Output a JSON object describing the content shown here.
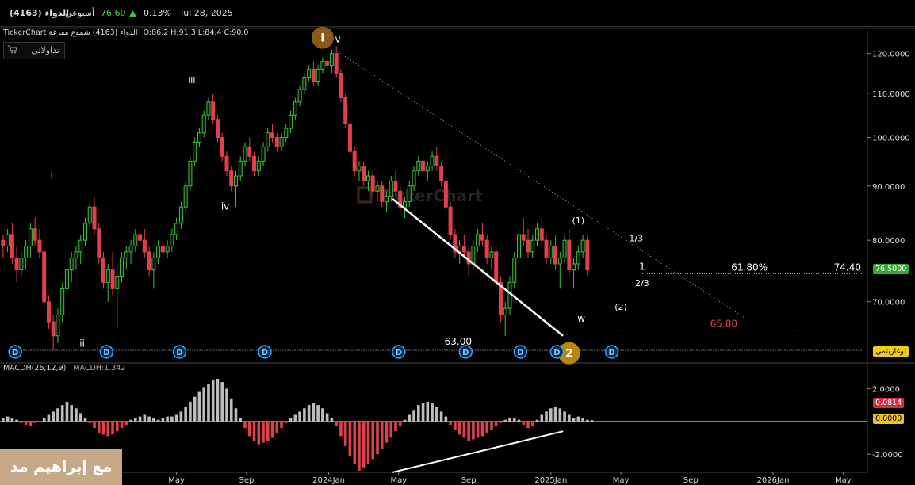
{
  "header": {
    "symbol": "الدواء (4163)",
    "period": "أسبوعي",
    "price": "76.60",
    "change_pct": "0.13%",
    "date": "Jul 28, 2025"
  },
  "info_line": {
    "brand": "TickerChart",
    "symbol": "الدواء (4163)",
    "chart_style": "شموع مفرغة",
    "ohlc": "O:86.2  H:91.3  L:84.4  C:90.0"
  },
  "toolbar": {
    "platform_label": "تداولاتي"
  },
  "watermark_text": "TickerChart",
  "footer_watermark": "مع إبراهيم مد",
  "colors": {
    "up": "#3fbf3f",
    "down": "#e0404a",
    "macd_up": "#bdbdbd",
    "macd_down": "#e0404a",
    "zero_line": "#e8a317",
    "price_tag": "#33aa33"
  },
  "chart_data": [
    {
      "type": "candlestick",
      "y_axis_labels": [
        "120.0000",
        "110.0000",
        "100.0000",
        "90.0000",
        "80.0000",
        "70.0000"
      ],
      "y_ticks": [
        120,
        110,
        100,
        90,
        80,
        70
      ],
      "ylim": [
        61.6,
        126.5
      ],
      "x_tick_labels": [
        "2023Jan",
        "May",
        "Sep",
        "2024Jan",
        "May",
        "Sep",
        "2025Jan",
        "May",
        "Sep",
        "2026Jan",
        "May"
      ],
      "x_tick_positions": [
        0.1,
        0.33,
        0.56,
        0.83,
        1.06,
        1.29,
        1.56,
        1.79,
        2.02,
        2.29,
        2.52
      ],
      "x_range": [
        -0.25,
        2.6
      ],
      "current_price": "76.5000",
      "scale_button": "لوغاريتمي",
      "levels": [
        {
          "value": 74.4,
          "label": "74.40",
          "pct_label": "61.80%"
        },
        {
          "value": 65.8,
          "label": "65.80"
        },
        {
          "value": 63.0,
          "label": "63.00"
        }
      ],
      "wave_labels": [
        {
          "text": "i",
          "t": -0.08,
          "y": 91.5
        },
        {
          "text": "ii",
          "t": 0.02,
          "y": 63.5
        },
        {
          "text": "iii",
          "t": 0.38,
          "y": 112.5
        },
        {
          "text": "iv",
          "t": 0.49,
          "y": 85.5
        },
        {
          "text": "v",
          "t": 0.86,
          "y": 123.0
        },
        {
          "text": "(1)",
          "t": 1.65,
          "y": 83.0
        },
        {
          "text": "(2)",
          "t": 1.79,
          "y": 68.8
        },
        {
          "text": "w",
          "t": 1.66,
          "y": 67.0
        },
        {
          "text": "1/3",
          "t": 1.84,
          "y": 79.8
        },
        {
          "text": "1",
          "t": 1.86,
          "y": 75.0
        },
        {
          "text": "2/3",
          "t": 1.86,
          "y": 72.4
        }
      ],
      "circle_labels": [
        {
          "text": "I",
          "t": 0.81,
          "y": 124.2,
          "color": "#8b5a1a"
        },
        {
          "text": "2",
          "t": 1.62,
          "y": 62.6,
          "color": "#b8860b"
        }
      ],
      "dividend_markers": {
        "label": "D",
        "t": [
          -0.2,
          0.1,
          0.34,
          0.62,
          1.06,
          1.28,
          1.46,
          1.58,
          1.76
        ]
      },
      "trendlines": [
        {
          "t1": 0.84,
          "y1": 121.5,
          "t2": 2.2,
          "y2": 67.5,
          "style": "dotted"
        },
        {
          "t1": 1.04,
          "y1": 87.5,
          "t2": 1.6,
          "y2": 65.0,
          "style": "solid"
        }
      ],
      "candles": [
        [
          -0.24,
          80,
          81,
          77,
          79
        ],
        [
          -0.225,
          79,
          82,
          78,
          81
        ],
        [
          -0.21,
          81,
          83,
          76,
          77
        ],
        [
          -0.195,
          77,
          79,
          73,
          75
        ],
        [
          -0.18,
          75,
          78,
          74,
          77
        ],
        [
          -0.165,
          77,
          80,
          75,
          79
        ],
        [
          -0.15,
          79,
          83,
          77,
          82
        ],
        [
          -0.135,
          82,
          84,
          79,
          80
        ],
        [
          -0.12,
          80,
          82,
          77,
          78
        ],
        [
          -0.105,
          78,
          79,
          69,
          70
        ],
        [
          -0.09,
          70,
          71,
          66,
          67
        ],
        [
          -0.075,
          67,
          68,
          63,
          65
        ],
        [
          -0.06,
          65,
          69,
          64,
          68
        ],
        [
          -0.045,
          68,
          73,
          67,
          72
        ],
        [
          -0.03,
          72,
          76,
          71,
          75
        ],
        [
          -0.015,
          75,
          78,
          73,
          77
        ],
        [
          0.0,
          77,
          79,
          75,
          78
        ],
        [
          0.015,
          78,
          81,
          76,
          80
        ],
        [
          0.03,
          80,
          84,
          79,
          83
        ],
        [
          0.045,
          83,
          87,
          82,
          86
        ],
        [
          0.06,
          86,
          88,
          81,
          82
        ],
        [
          0.075,
          82,
          83,
          76,
          77
        ],
        [
          0.09,
          77,
          78,
          72,
          73
        ],
        [
          0.105,
          73,
          76,
          70,
          75
        ],
        [
          0.12,
          75,
          78,
          71,
          72
        ],
        [
          0.135,
          72,
          76,
          66,
          74
        ],
        [
          0.15,
          74,
          78,
          73,
          77
        ],
        [
          0.165,
          77,
          79,
          75,
          78
        ],
        [
          0.18,
          78,
          80,
          76,
          79
        ],
        [
          0.195,
          79,
          82,
          78,
          81
        ],
        [
          0.21,
          81,
          83,
          79,
          80
        ],
        [
          0.225,
          80,
          82,
          77,
          78
        ],
        [
          0.24,
          78,
          79,
          74,
          75
        ],
        [
          0.255,
          75,
          78,
          72,
          77
        ],
        [
          0.27,
          77,
          80,
          76,
          79
        ],
        [
          0.285,
          79,
          80,
          77,
          78
        ],
        [
          0.3,
          78,
          80,
          77,
          79
        ],
        [
          0.315,
          79,
          82,
          78,
          81
        ],
        [
          0.33,
          81,
          84,
          80,
          83
        ],
        [
          0.345,
          83,
          87,
          82,
          86
        ],
        [
          0.36,
          86,
          91,
          85,
          90
        ],
        [
          0.375,
          90,
          96,
          89,
          95
        ],
        [
          0.39,
          95,
          100,
          94,
          99
        ],
        [
          0.405,
          99,
          102,
          98,
          101
        ],
        [
          0.42,
          101,
          106,
          100,
          105
        ],
        [
          0.435,
          105,
          109,
          104,
          108
        ],
        [
          0.45,
          108,
          110,
          103,
          104
        ],
        [
          0.465,
          104,
          105,
          99,
          100
        ],
        [
          0.48,
          100,
          101,
          95,
          96
        ],
        [
          0.495,
          96,
          97,
          92,
          93
        ],
        [
          0.51,
          93,
          94,
          89,
          90
        ],
        [
          0.525,
          90,
          93,
          86,
          92
        ],
        [
          0.54,
          92,
          96,
          91,
          95
        ],
        [
          0.555,
          95,
          99,
          94,
          98
        ],
        [
          0.57,
          98,
          100,
          95,
          96
        ],
        [
          0.585,
          96,
          97,
          92,
          93
        ],
        [
          0.6,
          93,
          96,
          92,
          95
        ],
        [
          0.615,
          95,
          99,
          94,
          98
        ],
        [
          0.63,
          98,
          102,
          97,
          101
        ],
        [
          0.645,
          101,
          103,
          99,
          100
        ],
        [
          0.66,
          100,
          101,
          97,
          98
        ],
        [
          0.675,
          98,
          101,
          97,
          100
        ],
        [
          0.69,
          100,
          103,
          99,
          102
        ],
        [
          0.705,
          102,
          106,
          101,
          105
        ],
        [
          0.72,
          105,
          109,
          104,
          108
        ],
        [
          0.735,
          108,
          112,
          107,
          111
        ],
        [
          0.75,
          111,
          115,
          110,
          114
        ],
        [
          0.765,
          114,
          117,
          113,
          116
        ],
        [
          0.78,
          116,
          118,
          112,
          113
        ],
        [
          0.795,
          113,
          117,
          112,
          116
        ],
        [
          0.81,
          116,
          119,
          115,
          118
        ],
        [
          0.825,
          118,
          120,
          116,
          117
        ],
        [
          0.84,
          117,
          121,
          115,
          120
        ],
        [
          0.855,
          120,
          122,
          114,
          115
        ],
        [
          0.87,
          115,
          116,
          108,
          109
        ],
        [
          0.885,
          109,
          110,
          102,
          103
        ],
        [
          0.9,
          103,
          104,
          96,
          97
        ],
        [
          0.915,
          97,
          98,
          92,
          93
        ],
        [
          0.93,
          93,
          95,
          91,
          94
        ],
        [
          0.945,
          94,
          95,
          90,
          91
        ],
        [
          0.96,
          91,
          93,
          89,
          92
        ],
        [
          0.975,
          92,
          93,
          88,
          89
        ],
        [
          0.99,
          89,
          91,
          87,
          90
        ],
        [
          1.005,
          90,
          91,
          86,
          87
        ],
        [
          1.02,
          87,
          89,
          85,
          88
        ],
        [
          1.035,
          88,
          92,
          87,
          91
        ],
        [
          1.05,
          91,
          93,
          88,
          89
        ],
        [
          1.065,
          89,
          90,
          85,
          86
        ],
        [
          1.08,
          86,
          88,
          84,
          87
        ],
        [
          1.095,
          87,
          91,
          86,
          90
        ],
        [
          1.11,
          90,
          94,
          89,
          93
        ],
        [
          1.125,
          93,
          96,
          92,
          95
        ],
        [
          1.14,
          95,
          97,
          92,
          93
        ],
        [
          1.155,
          93,
          95,
          91,
          94
        ],
        [
          1.17,
          94,
          97,
          93,
          96
        ],
        [
          1.185,
          96,
          98,
          93,
          94
        ],
        [
          1.2,
          94,
          95,
          90,
          91
        ],
        [
          1.215,
          91,
          92,
          85,
          86
        ],
        [
          1.23,
          86,
          87,
          80,
          81
        ],
        [
          1.245,
          81,
          82,
          77,
          78
        ],
        [
          1.26,
          78,
          80,
          76,
          79
        ],
        [
          1.275,
          79,
          81,
          77,
          78
        ],
        [
          1.29,
          78,
          79,
          74,
          76
        ],
        [
          1.305,
          76,
          80,
          75,
          79
        ],
        [
          1.32,
          79,
          82,
          78,
          81
        ],
        [
          1.335,
          81,
          83,
          79,
          80
        ],
        [
          1.35,
          80,
          81,
          76,
          77
        ],
        [
          1.365,
          77,
          79,
          75,
          78
        ],
        [
          1.38,
          78,
          79,
          72,
          73
        ],
        [
          1.395,
          73,
          74,
          67,
          68
        ],
        [
          1.41,
          68,
          70,
          65,
          69
        ],
        [
          1.425,
          69,
          74,
          68,
          73
        ],
        [
          1.44,
          73,
          78,
          72,
          77
        ],
        [
          1.455,
          77,
          82,
          76,
          81
        ],
        [
          1.47,
          81,
          84,
          79,
          80
        ],
        [
          1.485,
          80,
          82,
          77,
          78
        ],
        [
          1.5,
          78,
          81,
          77,
          80
        ],
        [
          1.515,
          80,
          83,
          79,
          82
        ],
        [
          1.53,
          82,
          84,
          79,
          80
        ],
        [
          1.545,
          80,
          81,
          76,
          77
        ],
        [
          1.56,
          77,
          80,
          76,
          79
        ],
        [
          1.575,
          79,
          81,
          75,
          76
        ],
        [
          1.59,
          76,
          78,
          72,
          77
        ],
        [
          1.605,
          77,
          81,
          76,
          80
        ],
        [
          1.62,
          80,
          82,
          74,
          75
        ],
        [
          1.635,
          75,
          77,
          72,
          76
        ],
        [
          1.65,
          76,
          79,
          75,
          78
        ],
        [
          1.665,
          78,
          81,
          77,
          80
        ],
        [
          1.68,
          80,
          81,
          74,
          75
        ]
      ],
      "candles_note": ""
    },
    {
      "type": "bar",
      "name": "MACDH(26,12,9)",
      "value_label": "MACDH:1.342",
      "y_axis_labels": [
        "2.0000",
        "-2.0000"
      ],
      "y_ticks": [
        2,
        -2
      ],
      "ylim": [
        -3.2,
        2.6
      ],
      "last_value_tag": "0.0814",
      "zero_tag": "0.0000",
      "x_start": -0.24,
      "x_step": 0.015,
      "values": [
        0.2,
        0.3,
        0.2,
        0.1,
        -0.1,
        -0.2,
        -0.3,
        -0.1,
        0.0,
        0.2,
        0.4,
        0.6,
        0.8,
        1.0,
        1.2,
        1.0,
        0.8,
        0.5,
        0.2,
        -0.1,
        -0.4,
        -0.7,
        -0.8,
        -0.9,
        -0.8,
        -0.6,
        -0.4,
        -0.2,
        0.1,
        0.2,
        0.3,
        0.4,
        0.3,
        0.2,
        0.1,
        0.2,
        0.3,
        0.3,
        0.4,
        0.6,
        0.9,
        1.2,
        1.5,
        1.8,
        2.1,
        2.3,
        2.5,
        2.6,
        2.4,
        2.0,
        1.4,
        0.8,
        0.2,
        -0.4,
        -0.9,
        -1.2,
        -1.4,
        -1.3,
        -1.2,
        -1.0,
        -0.7,
        -0.4,
        -0.1,
        0.2,
        0.4,
        0.6,
        0.8,
        1.0,
        1.1,
        1.0,
        0.8,
        0.5,
        0.2,
        -0.3,
        -0.9,
        -1.5,
        -2.1,
        -2.6,
        -3.0,
        -2.8,
        -2.6,
        -2.3,
        -2.0,
        -1.7,
        -1.3,
        -1.0,
        -0.6,
        -0.3,
        0.1,
        0.4,
        0.7,
        1.0,
        1.1,
        1.2,
        1.1,
        0.9,
        0.6,
        0.3,
        -0.2,
        -0.5,
        -0.8,
        -1.0,
        -1.2,
        -1.1,
        -1.0,
        -0.9,
        -0.7,
        -0.5,
        -0.3,
        -0.1,
        0.1,
        0.2,
        0.2,
        0.1,
        -0.2,
        -0.4,
        -0.3,
        0.1,
        0.4,
        0.6,
        0.8,
        0.9,
        0.8,
        0.6,
        0.4,
        0.2,
        0.3,
        0.2,
        0.1,
        0.08
      ],
      "trendlines": [
        {
          "t1": 1.04,
          "y1": -3.1,
          "t2": 1.6,
          "y2": -0.6
        }
      ]
    }
  ]
}
